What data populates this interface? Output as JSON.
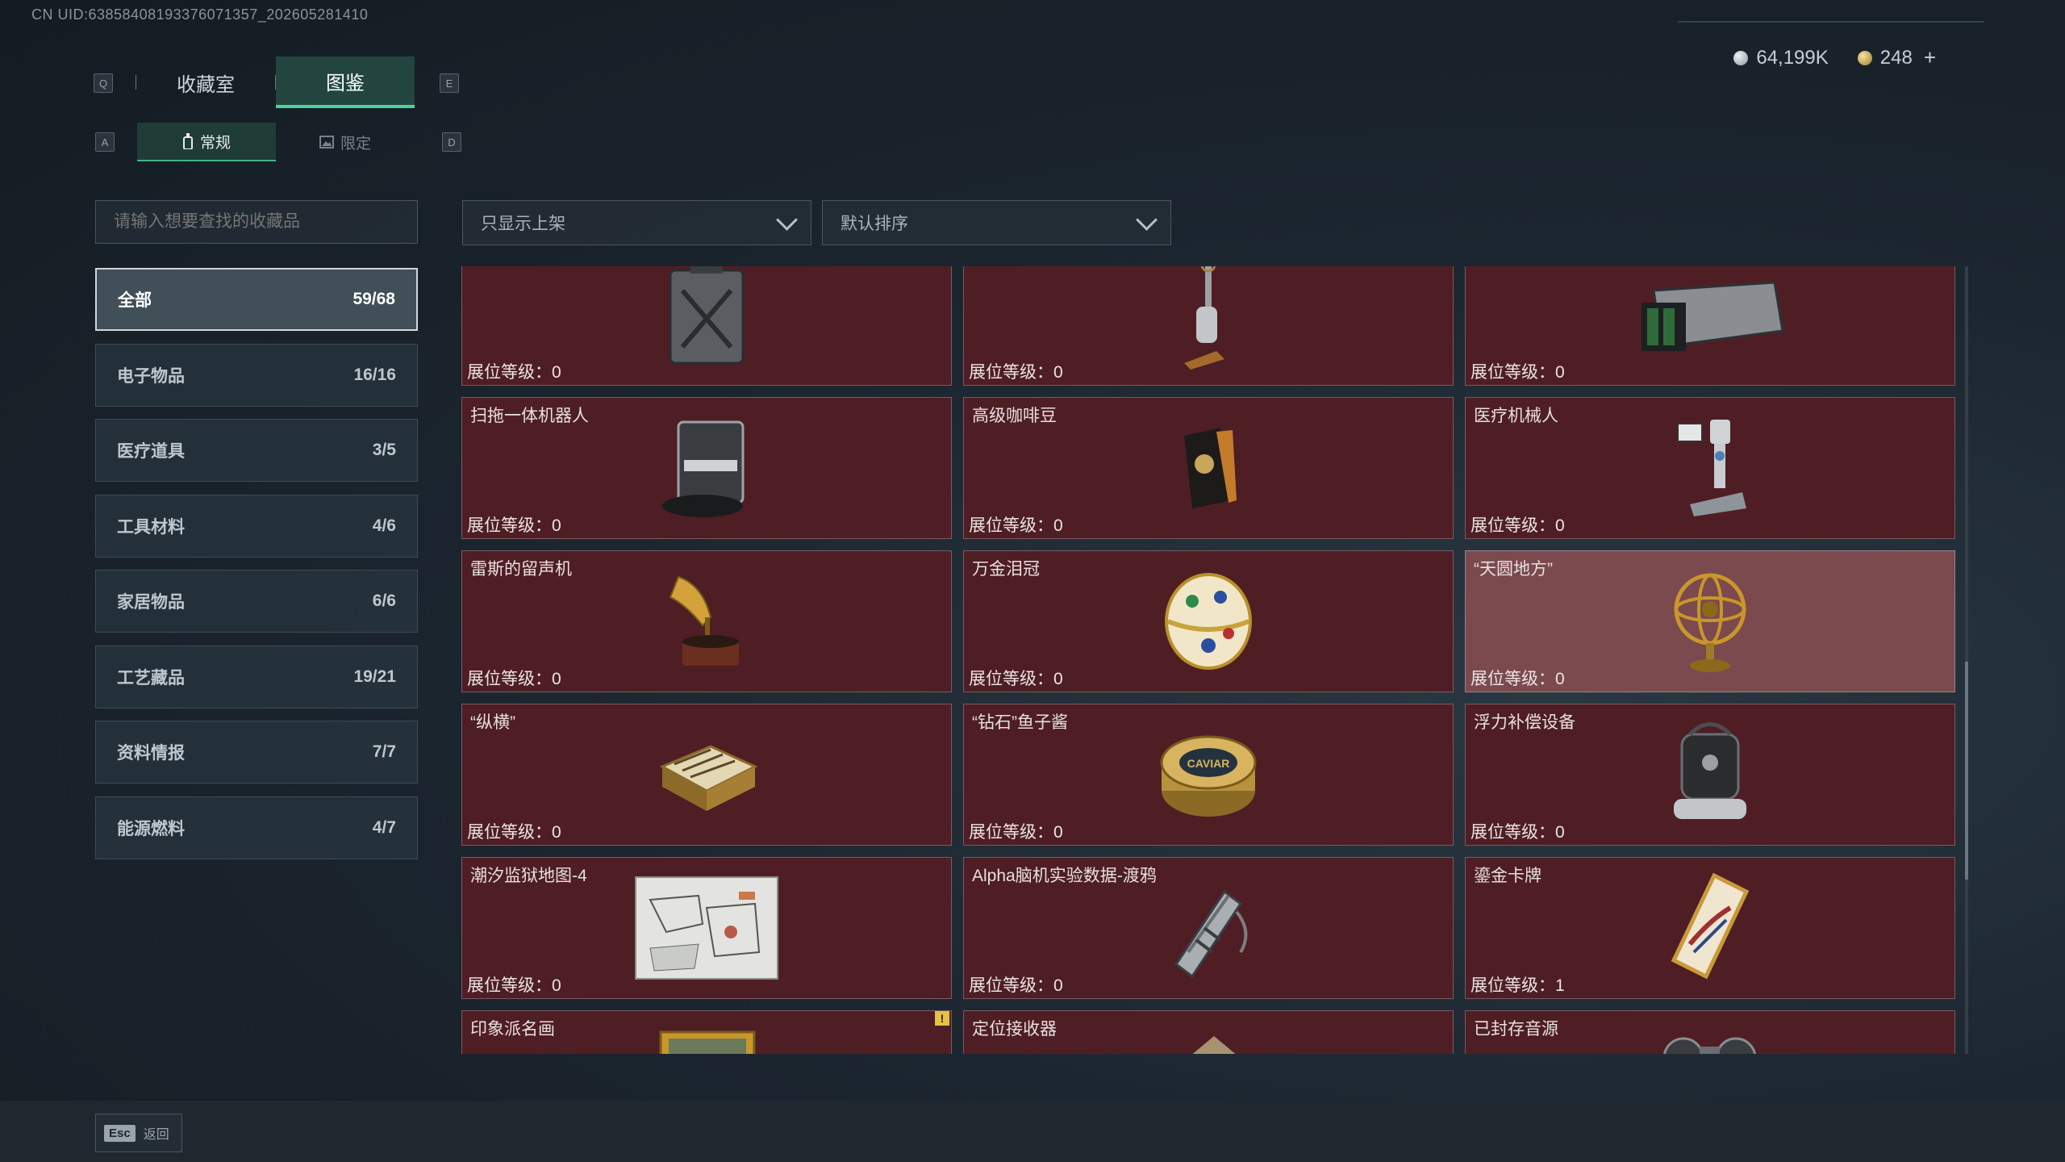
{
  "header": {
    "uid": "CN UID:638584081933760713​57_202605281410",
    "currency": [
      {
        "icon": "silver-coin-icon",
        "value": "64,199K"
      },
      {
        "icon": "gold-coin-icon",
        "value": "248"
      }
    ],
    "plus": "+"
  },
  "keys": {
    "prev_tab": "Q",
    "next_tab": "E",
    "prev_sub": "A",
    "next_sub": "D"
  },
  "tabs": [
    {
      "label": "收藏室",
      "active": false
    },
    {
      "label": "图鉴",
      "active": true
    }
  ],
  "subtabs": [
    {
      "label": "常规",
      "icon": "bottle-icon",
      "active": true
    },
    {
      "label": "限定",
      "icon": "image-icon",
      "active": false
    }
  ],
  "search": {
    "placeholder": "请输入想要查找的收藏品"
  },
  "categories": [
    {
      "label": "全部",
      "count": "59/68",
      "active": true
    },
    {
      "label": "电子物品",
      "count": "16/16"
    },
    {
      "label": "医疗道具",
      "count": "3/5"
    },
    {
      "label": "工具材料",
      "count": "4/6"
    },
    {
      "label": "家居物品",
      "count": "6/6"
    },
    {
      "label": "工艺藏品",
      "count": "19/21"
    },
    {
      "label": "资料情报",
      "count": "7/7"
    },
    {
      "label": "能源燃料",
      "count": "4/7"
    }
  ],
  "filters": {
    "shelf": "只显示上架",
    "sort": "默认排序"
  },
  "level_prefix": "展位等级：",
  "items": [
    {
      "name": "",
      "level": "0",
      "icon": "jerrycan-icon"
    },
    {
      "name": "",
      "level": "0",
      "icon": "vacuum-icon"
    },
    {
      "name": "",
      "level": "0",
      "icon": "server-unit-icon"
    },
    {
      "name": "扫拖一体机器人",
      "level": "0",
      "icon": "mop-robot-icon"
    },
    {
      "name": "高级咖啡豆",
      "level": "0",
      "icon": "coffee-bag-icon"
    },
    {
      "name": "医疗机械人",
      "level": "0",
      "icon": "medical-robot-icon"
    },
    {
      "name": "雷斯的留声机",
      "level": "0",
      "icon": "gramophone-icon"
    },
    {
      "name": "万金泪冠",
      "level": "0",
      "icon": "jeweled-egg-icon"
    },
    {
      "name": "“天圆地方”",
      "level": "0",
      "icon": "armillary-sphere-icon",
      "highlight": true
    },
    {
      "name": "“纵横”",
      "level": "0",
      "icon": "chess-box-icon"
    },
    {
      "name": "“钻石”鱼子酱",
      "level": "0",
      "icon": "caviar-tin-icon",
      "label": "CAVIAR"
    },
    {
      "name": "浮力补偿设备",
      "level": "0",
      "icon": "buoyancy-device-icon"
    },
    {
      "name": "潮汐监狱地图-4",
      "level": "0",
      "icon": "map-icon"
    },
    {
      "name": "Alpha脑机实验数据-渡鸦",
      "level": "0",
      "icon": "data-canister-icon"
    },
    {
      "name": "鎏金卡牌",
      "level": "1",
      "icon": "gold-card-icon"
    },
    {
      "name": "印象派名画",
      "level": "",
      "icon": "painting-icon",
      "warn": "!"
    },
    {
      "name": "定位接收器",
      "level": "",
      "icon": "receiver-icon"
    },
    {
      "name": "已封存音源",
      "level": "",
      "icon": "reel-icon"
    }
  ],
  "footer": {
    "esc": "Esc",
    "back": "返回"
  }
}
